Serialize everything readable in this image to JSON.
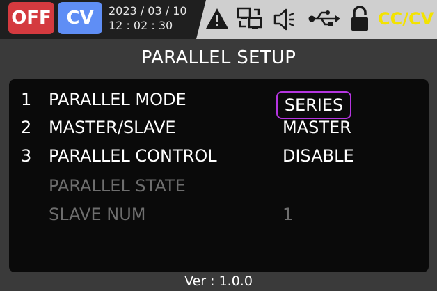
{
  "status_bar": {
    "output_state": "OFF",
    "mode": "CV",
    "date": "2023 / 03 / 10",
    "time": "12 : 02 : 30",
    "icons": [
      "warning-icon",
      "network-icon",
      "speaker-icon",
      "usb-icon",
      "lock-icon"
    ],
    "regulation_mode": "CC/CV"
  },
  "colors": {
    "off_badge": "#d43a3f",
    "cv_badge": "#5f8ef5",
    "cccv_text": "#f3e300",
    "selection_border": "#b535e0"
  },
  "page_title": "PARALLEL SETUP",
  "settings": [
    {
      "num": "1",
      "label": "PARALLEL MODE",
      "value": "SERIES",
      "enabled": true,
      "selected": true
    },
    {
      "num": "2",
      "label": "MASTER/SLAVE",
      "value": "MASTER",
      "enabled": true,
      "selected": false
    },
    {
      "num": "3",
      "label": "PARALLEL CONTROL",
      "value": "DISABLE",
      "enabled": true,
      "selected": false
    },
    {
      "num": "",
      "label": "PARALLEL STATE",
      "value": "",
      "enabled": false,
      "selected": false
    },
    {
      "num": "",
      "label": "SLAVE NUM",
      "value": "1",
      "enabled": false,
      "selected": false
    }
  ],
  "version": "Ver :  1.0.0"
}
